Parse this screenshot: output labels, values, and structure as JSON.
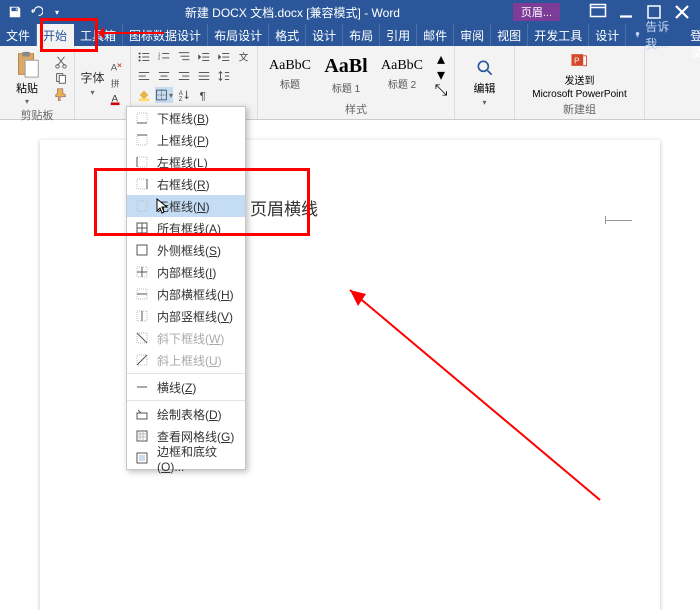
{
  "titlebar": {
    "title": "新建 DOCX 文档.docx [兼容模式] - Word",
    "context_tab": "页眉..."
  },
  "tabs": [
    "文件",
    "开始",
    "工具箱",
    "图标数据设计",
    "布局设计",
    "格式",
    "设计",
    "布局",
    "引用",
    "邮件",
    "审阅",
    "视图",
    "开发工具"
  ],
  "tabs_right": {
    "design": "设计",
    "tellme": "告诉我...",
    "login": "登录"
  },
  "ribbon": {
    "clipboard": {
      "paste": "粘贴",
      "group": "剪贴板"
    },
    "font": {
      "label": "字体",
      "group": ""
    },
    "para": {
      "group": ""
    },
    "styles": {
      "items": [
        {
          "sample": "AaBbC",
          "label": "标题",
          "size": "14px"
        },
        {
          "sample": "AaBl",
          "label": "标题 1",
          "size": "20px"
        },
        {
          "sample": "AaBbC",
          "label": "标题 2",
          "size": "14px"
        }
      ],
      "group": "样式"
    },
    "edit": {
      "label": "编辑",
      "group": ""
    },
    "newg": {
      "line1": "发送到",
      "line2": "Microsoft PowerPoint",
      "group": "新建组"
    }
  },
  "menu": {
    "items": [
      {
        "label": "下框线",
        "key": "B"
      },
      {
        "label": "上框线",
        "key": "P"
      },
      {
        "label": "左框线",
        "key": "L"
      },
      {
        "label": "右框线",
        "key": "R"
      },
      {
        "label": "无框线",
        "key": "N",
        "hover": true
      },
      {
        "label": "所有框线",
        "key": "A"
      },
      {
        "label": "外侧框线",
        "key": "S"
      },
      {
        "label": "内部框线",
        "key": "I"
      },
      {
        "label": "内部横框线",
        "key": "H"
      },
      {
        "label": "内部竖框线",
        "key": "V"
      },
      {
        "label": "斜下框线",
        "key": "W",
        "disabled": true
      },
      {
        "label": "斜上框线",
        "key": "U",
        "disabled": true
      },
      {
        "sep": true
      },
      {
        "label": "横线",
        "key": "Z"
      },
      {
        "sep": true
      },
      {
        "label": "绘制表格",
        "key": "D"
      },
      {
        "label": "查看网格线",
        "key": "G"
      },
      {
        "label": "边框和底纹",
        "key": "O",
        "ell": true
      }
    ]
  },
  "doc": {
    "text": "页眉横线"
  }
}
